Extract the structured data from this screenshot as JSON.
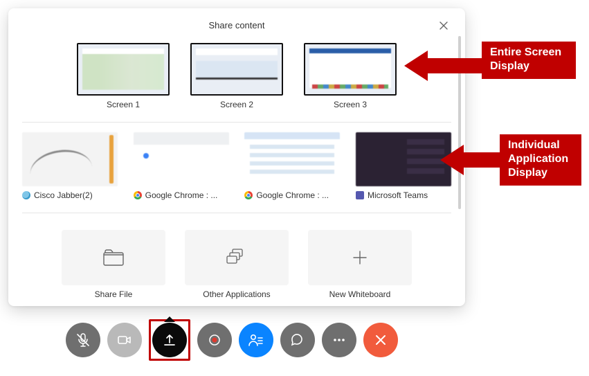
{
  "panel": {
    "title": "Share content"
  },
  "screens": [
    {
      "label": "Screen 1"
    },
    {
      "label": "Screen 2"
    },
    {
      "label": "Screen 3"
    }
  ],
  "apps": [
    {
      "label": "Cisco Jabber(2)",
      "icon": "jabber"
    },
    {
      "label": "Google Chrome : ...",
      "icon": "chrome"
    },
    {
      "label": "Google Chrome : ...",
      "icon": "chrome"
    },
    {
      "label": "Microsoft Teams",
      "icon": "teams"
    }
  ],
  "actions": {
    "share_file": "Share File",
    "other_apps": "Other Applications",
    "new_whiteboard": "New Whiteboard"
  },
  "callouts": {
    "screens": "Entire Screen\nDisplay",
    "apps": "Individual\nApplication\nDisplay"
  },
  "colors": {
    "accent_red": "#c00000",
    "toolbar_blue": "#0a84ff",
    "hangup_red": "#f15b3c"
  }
}
